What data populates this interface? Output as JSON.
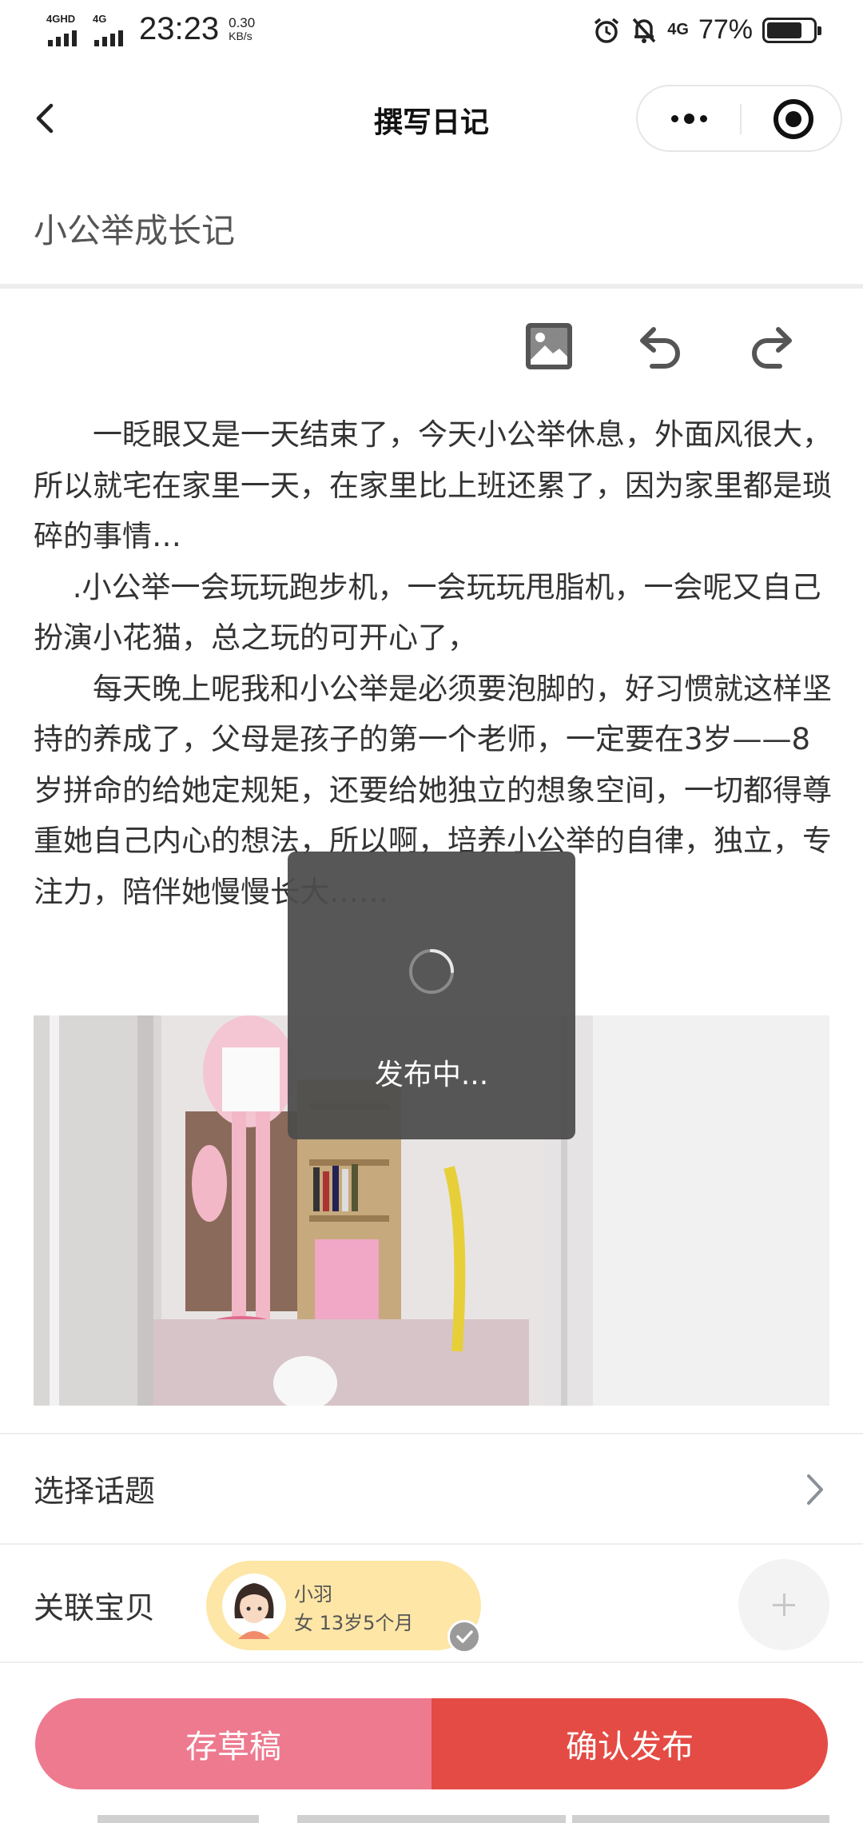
{
  "status_bar": {
    "network1": "4GHD",
    "network2": "4G",
    "time": "23:23",
    "speed_value": "0.30",
    "speed_unit": "KB/s",
    "network_right": "4G",
    "battery_percent": "77%",
    "battery_level": 0.77
  },
  "nav": {
    "title": "撰写日记"
  },
  "diary": {
    "title": "小公举成长记",
    "paragraphs": [
      "　　一眨眼又是一天结束了，今天小公举休息，外面风很大，所以就宅在家里一天，在家里比上班还累了，因为家里都是琐碎的事情…",
      "　 .小公举一会玩玩跑步机，一会玩玩甩脂机，一会呢又自己扮演小花猫，总之玩的可开心了，",
      "　　每天晚上呢我和小公举是必须要泡脚的，好习惯就这样坚持的养成了，父母是孩子的第一个老师，一定要在3岁——8岁拼命的给她定规矩，还要给她独立的想象空间，一切都得尊重她自己内心的想法，所以啊，培养小公举的自律，独立，专注力，陪伴她慢慢长大……"
    ]
  },
  "topic": {
    "label": "选择话题"
  },
  "baby": {
    "label": "关联宝贝",
    "name": "小羽",
    "meta": "女  13岁5个月"
  },
  "actions": {
    "draft": "存草稿",
    "publish": "确认发布"
  },
  "toast": {
    "message": "发布中..."
  },
  "colors": {
    "draft_button": "#ee7a8f",
    "publish_button": "#e44b44",
    "baby_chip": "#fde6a6"
  }
}
